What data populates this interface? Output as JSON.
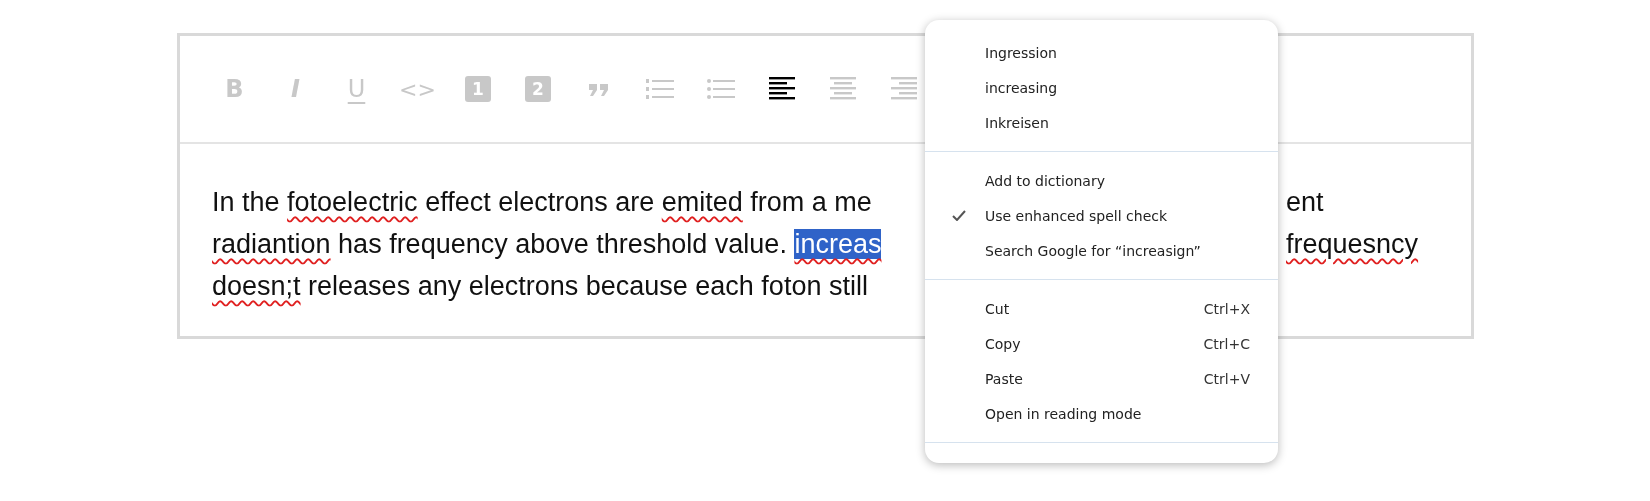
{
  "toolbar": [
    {
      "kind": "bold",
      "label": "B",
      "active": false
    },
    {
      "kind": "italic",
      "label": "I",
      "active": false
    },
    {
      "kind": "underline",
      "label": "U",
      "active": false
    },
    {
      "kind": "code",
      "label": "<>",
      "active": false
    },
    {
      "kind": "heading",
      "label": "1",
      "active": false
    },
    {
      "kind": "heading",
      "label": "2",
      "active": false
    },
    {
      "kind": "quote",
      "active": false
    },
    {
      "kind": "ordered-list",
      "active": false
    },
    {
      "kind": "bullet-list",
      "active": false
    },
    {
      "kind": "align-left",
      "active": true
    },
    {
      "kind": "align-center",
      "active": false
    },
    {
      "kind": "align-right",
      "active": false
    }
  ],
  "lines": [
    {
      "left": [
        {
          "text": "In the ",
          "misspelled": false,
          "selected": false
        },
        {
          "text": "fotoelectric",
          "misspelled": true,
          "selected": false
        },
        {
          "text": " effect electrons are ",
          "misspelled": false,
          "selected": false
        },
        {
          "text": "emited",
          "misspelled": true,
          "selected": false
        },
        {
          "text": " from a me",
          "misspelled": false,
          "selected": false
        }
      ],
      "right": [
        {
          "text": "ent",
          "misspelled": false,
          "selected": false
        }
      ]
    },
    {
      "left": [
        {
          "text": "radiantion",
          "misspelled": true,
          "selected": false
        },
        {
          "text": " has frequency above threshold value. ",
          "misspelled": false,
          "selected": false
        },
        {
          "text": "increas",
          "misspelled": true,
          "selected": true
        }
      ],
      "right": [
        {
          "text": "frequesncy",
          "misspelled": true,
          "selected": false
        }
      ]
    },
    {
      "left": [
        {
          "text": "doesn;t",
          "misspelled": true,
          "selected": false
        },
        {
          "text": " releases any electrons because each foton still",
          "misspelled": false,
          "selected": false
        }
      ]
    }
  ],
  "context_menu": {
    "groups": [
      [
        {
          "label": "Ingression",
          "checked": false
        },
        {
          "label": "increasing",
          "checked": false
        },
        {
          "label": "Inkreisen",
          "checked": false
        }
      ],
      [
        {
          "label": "Add to dictionary",
          "checked": false
        },
        {
          "label": "Use enhanced spell check",
          "checked": true
        },
        {
          "label": "Search Google for “increasign”",
          "checked": false
        }
      ],
      [
        {
          "label": "Cut",
          "shortcut": "Ctrl+X",
          "checked": false
        },
        {
          "label": "Copy",
          "shortcut": "Ctrl+C",
          "checked": false
        },
        {
          "label": "Paste",
          "shortcut": "Ctrl+V",
          "checked": false
        },
        {
          "label": "Open in reading mode",
          "checked": false
        }
      ]
    ]
  }
}
